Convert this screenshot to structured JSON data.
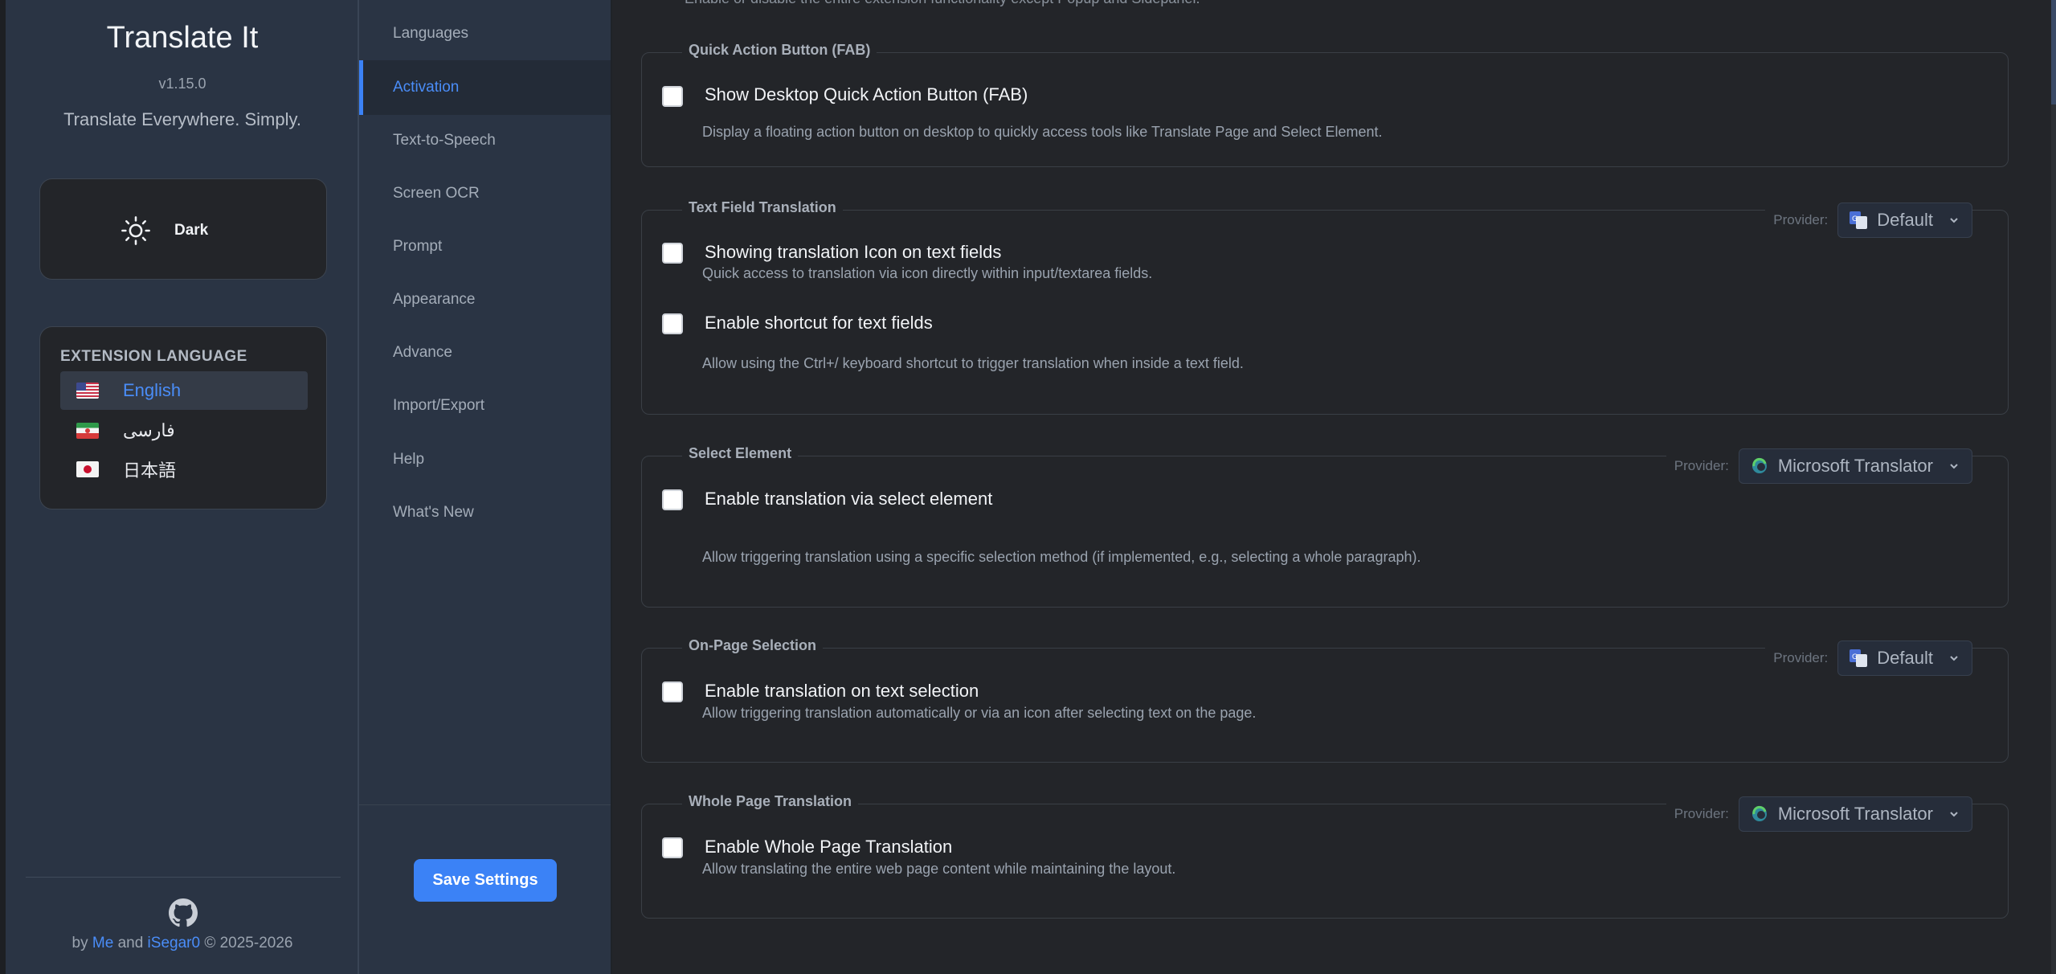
{
  "app": {
    "title": "Translate It",
    "version": "v1.15.0",
    "tagline": "Translate Everywhere. Simply."
  },
  "theme": {
    "label": "Dark",
    "icon": "sun-icon"
  },
  "extension_language": {
    "heading": "EXTENSION LANGUAGE",
    "items": [
      {
        "label": "English",
        "flag": "us-flag-icon",
        "active": true
      },
      {
        "label": "فارسی",
        "flag": "iran-flag-icon",
        "active": false
      },
      {
        "label": "日本語",
        "flag": "japan-flag-icon",
        "active": false
      }
    ]
  },
  "footer": {
    "by": "by",
    "me": "Me",
    "and": "and",
    "author": "iSegar0",
    "copyright": "© 2025-2026"
  },
  "nav": {
    "items": [
      {
        "label": "Languages"
      },
      {
        "label": "Activation",
        "active": true
      },
      {
        "label": "Text-to-Speech"
      },
      {
        "label": "Screen OCR"
      },
      {
        "label": "Prompt"
      },
      {
        "label": "Appearance"
      },
      {
        "label": "Advance"
      },
      {
        "label": "Import/Export"
      },
      {
        "label": "Help"
      },
      {
        "label": "What's New"
      }
    ],
    "save_label": "Save Settings"
  },
  "main": {
    "top_cut_text": "Enable or disable the entire extension functionality except Popup and Sidepanel.",
    "sections": {
      "fab": {
        "title": "Quick Action Button (FAB)",
        "option": "Show Desktop Quick Action Button (FAB)",
        "desc": "Display a floating action button on desktop to quickly access tools like Translate Page and Select Element."
      },
      "text_field": {
        "title": "Text Field Translation",
        "provider_label": "Provider:",
        "provider": "Default",
        "option1": "Showing translation Icon on text fields",
        "desc1": "Quick access to translation via icon directly within input/textarea fields.",
        "option2": "Enable shortcut for text fields",
        "desc2": "Allow using the Ctrl+/ keyboard shortcut to trigger translation when inside a text field."
      },
      "select_element": {
        "title": "Select Element",
        "provider_label": "Provider:",
        "provider": "Microsoft Translator",
        "option": "Enable translation via select element",
        "desc": "Allow triggering translation using a specific selection method (if implemented, e.g., selecting a whole paragraph)."
      },
      "on_page": {
        "title": "On-Page Selection",
        "provider_label": "Provider:",
        "provider": "Default",
        "option": "Enable translation on text selection",
        "desc": "Allow triggering translation automatically or via an icon after selecting text on the page."
      },
      "whole_page": {
        "title": "Whole Page Translation",
        "provider_label": "Provider:",
        "provider": "Microsoft Translator",
        "option": "Enable Whole Page Translation",
        "desc": "Allow translating the entire web page content while maintaining the layout."
      }
    }
  },
  "colors": {
    "accent": "#3b82f6",
    "link": "#4a8df8",
    "panel": "#2a3444",
    "bg": "#232529"
  }
}
